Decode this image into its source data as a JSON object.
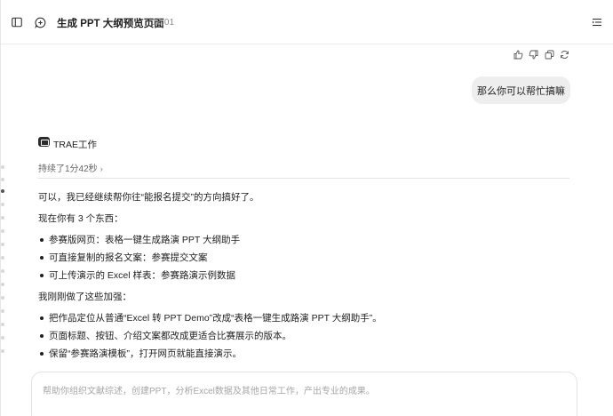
{
  "header": {
    "title": "生成 PPT 大纲预览页面",
    "time": "10:01",
    "sidebar_toggle_icon": "sidebar-panel-icon",
    "new_chat_icon": "new-chat-icon",
    "menu_icon": "list-menu-icon"
  },
  "user_message": {
    "text": "那么你可以帮忙搞嘛"
  },
  "agent": {
    "name": "TRAE工作",
    "duration": "持续了1分42秒",
    "content": {
      "intro": "可以，我已经继续帮你往“能报名提交”的方向搞好了。",
      "heading1": "现在你有 3 个东西：",
      "list1": [
        "参赛版网页：表格一键生成路演 PPT 大纲助手",
        "可直接复制的报名文案：参赛提交文案",
        "可上传演示的 Excel 样表：参赛路演示例数据"
      ],
      "heading2": "我刚刚做了这些加强：",
      "list2": [
        "把作品定位从普通“Excel 转 PPT Demo”改成“表格一键生成路演 PPT 大纲助手”。",
        "页面标题、按钮、介绍文案都改成更适合比赛展示的版本。",
        "保留“参赛路演模板”，打开网页就能直接演示。"
      ]
    }
  },
  "input": {
    "placeholder": "帮助你组织文献综述，创建PPT，分析Excel数据及其他日常工作，产出专业的成果。"
  }
}
